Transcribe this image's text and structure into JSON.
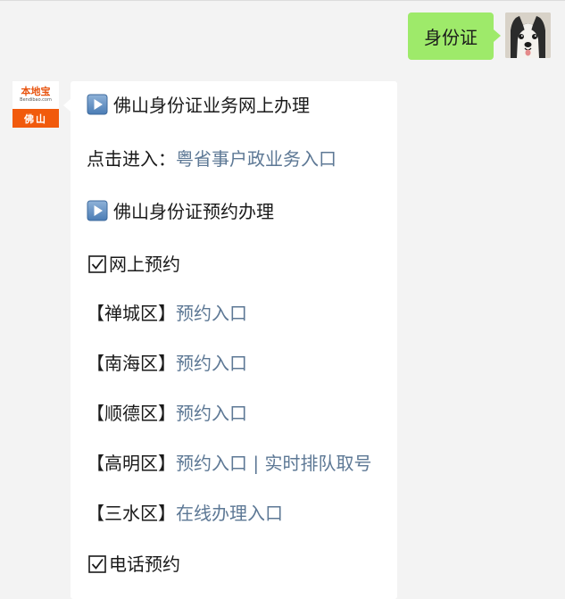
{
  "user_message": {
    "text": "身份证"
  },
  "bot": {
    "avatar": {
      "brand_name": "本地宝",
      "brand_url": "Bendibao.com",
      "city": "佛山"
    },
    "lines": {
      "heading_online": "佛山身份证业务网上办理",
      "click_enter_label": "点击进入：",
      "click_enter_link": "粤省事户政业务入口",
      "heading_appointment": "佛山身份证预约办理",
      "online_appointment": "网上预约",
      "chancheng_label": "【禅城区】",
      "chancheng_link": "预约入口",
      "nanhai_label": "【南海区】",
      "nanhai_link": "预约入口",
      "shunde_label": "【顺德区】",
      "shunde_link": "预约入口",
      "gaoming_label": "【高明区】",
      "gaoming_link_1": "预约入口",
      "gaoming_sep": " | ",
      "gaoming_link_2": "实时排队取号",
      "sanshui_label": "【三水区】",
      "sanshui_link": "在线办理入口",
      "phone_appointment": "电话预约"
    }
  },
  "colors": {
    "user_bubble": "#9eea6a",
    "link": "#5d7895",
    "brand_orange": "#f15a0c",
    "background": "#f3f3f3"
  },
  "icons": {
    "play": "play-button-icon",
    "check": "check-box-icon"
  }
}
